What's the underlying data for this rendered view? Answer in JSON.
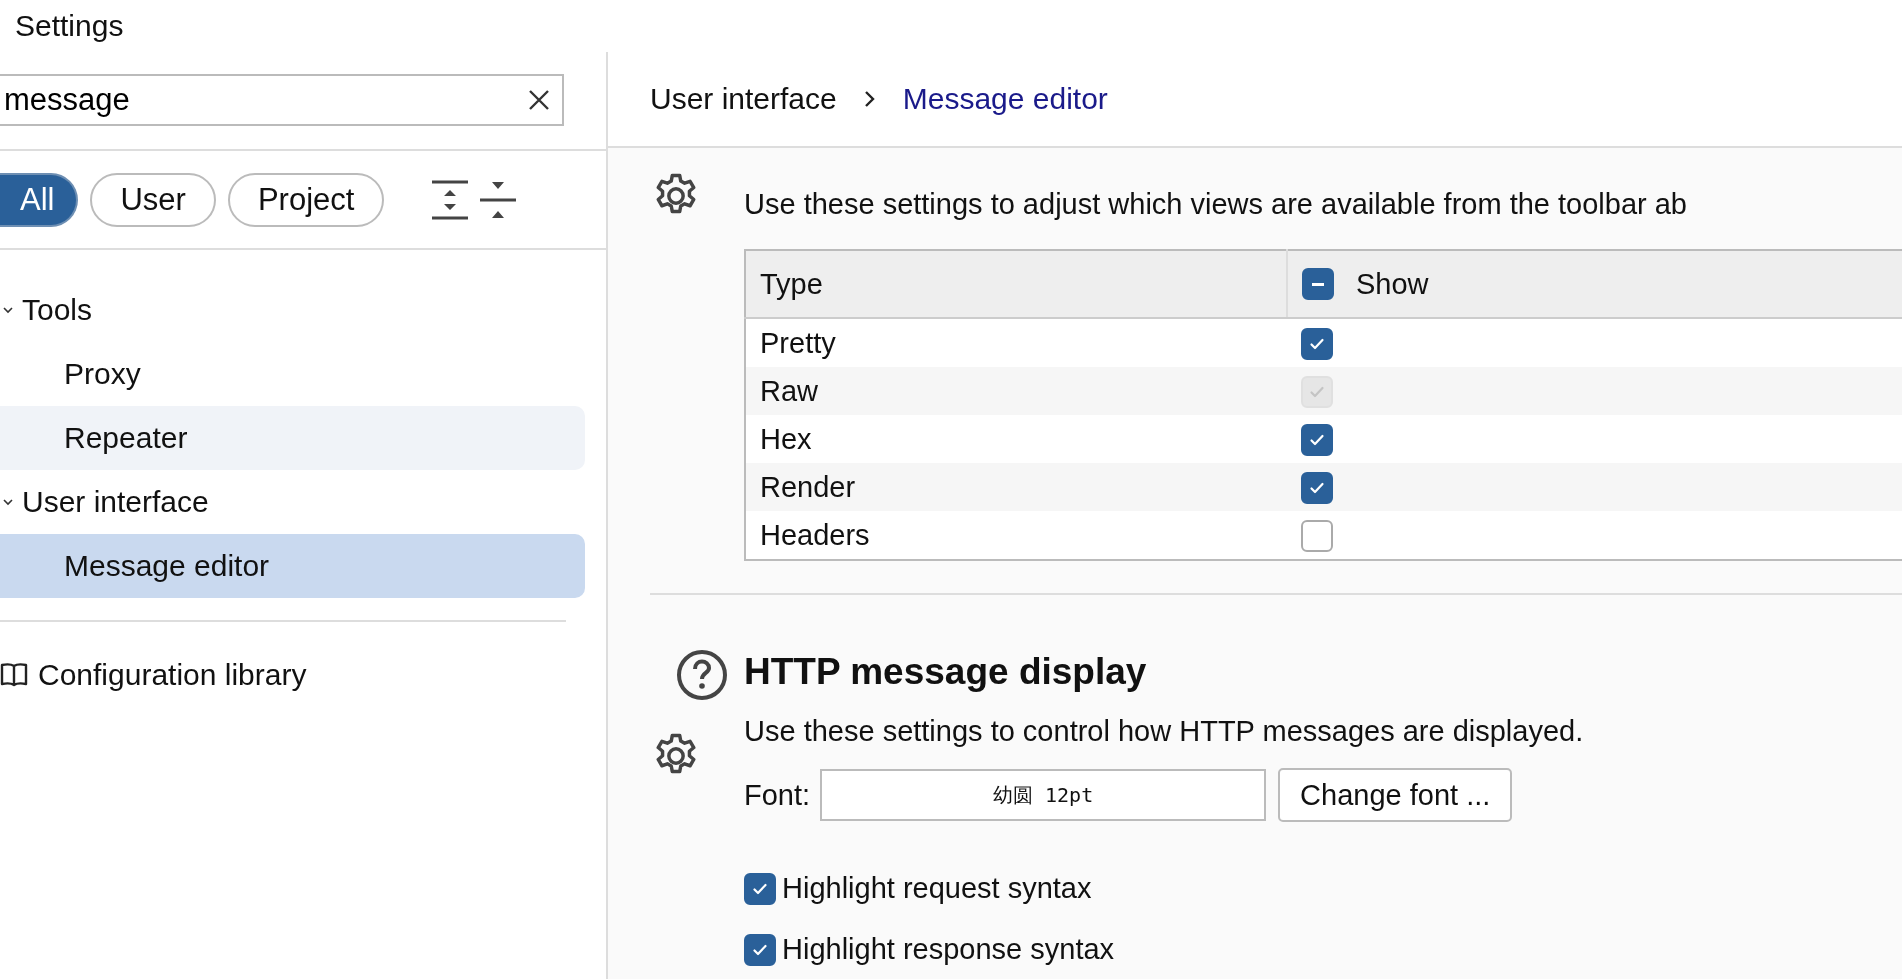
{
  "window": {
    "title": "Settings"
  },
  "search": {
    "value": "message"
  },
  "filters": [
    {
      "label": "All",
      "selected": true
    },
    {
      "label": "User",
      "selected": false
    },
    {
      "label": "Project",
      "selected": false
    }
  ],
  "tree": [
    {
      "label": "Tools",
      "expanded": true,
      "children": [
        {
          "label": "Proxy",
          "selected": false,
          "hovered": false
        },
        {
          "label": "Repeater",
          "selected": false,
          "hovered": true
        }
      ]
    },
    {
      "label": "User interface",
      "expanded": true,
      "children": [
        {
          "label": "Message editor",
          "selected": true,
          "hovered": false
        }
      ]
    }
  ],
  "library": {
    "label": "Configuration library"
  },
  "breadcrumb": [
    {
      "label": "User interface",
      "current": false
    },
    {
      "label": "Message editor",
      "current": true
    }
  ],
  "views_section": {
    "description": "Use these settings to adjust which views are available from the toolbar ab",
    "table": {
      "columns": [
        "Type",
        "Show"
      ],
      "header_indeterminate": true,
      "rows": [
        {
          "type": "Pretty",
          "show": true,
          "disabled": false
        },
        {
          "type": "Raw",
          "show": true,
          "disabled": true
        },
        {
          "type": "Hex",
          "show": true,
          "disabled": false
        },
        {
          "type": "Render",
          "show": true,
          "disabled": false
        },
        {
          "type": "Headers",
          "show": false,
          "disabled": false
        }
      ]
    }
  },
  "display_section": {
    "title": "HTTP message display",
    "description": "Use these settings to control how HTTP messages are displayed.",
    "font_label": "Font:",
    "font_value": "幼圆 12pt",
    "button": "Change font ...",
    "options": [
      {
        "label": "Highlight request syntax",
        "checked": true
      },
      {
        "label": "Highlight response syntax",
        "checked": true
      }
    ]
  }
}
